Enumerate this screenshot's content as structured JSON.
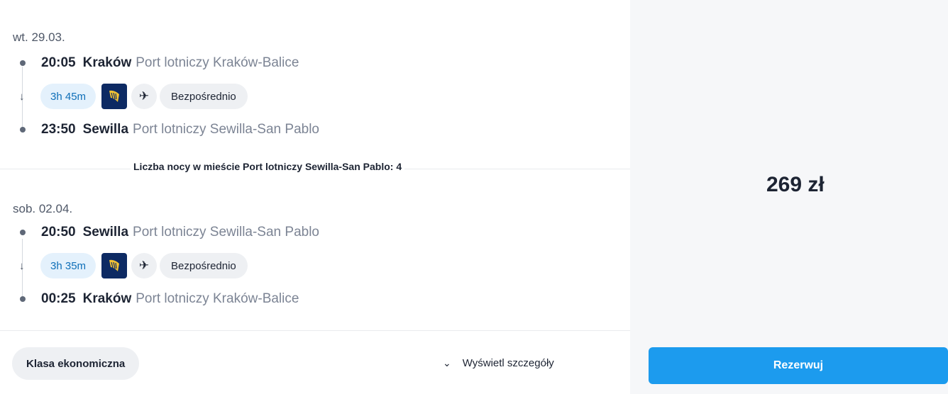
{
  "outbound": {
    "date": "wt. 29.03.",
    "departure": {
      "time": "20:05",
      "city": "Kraków",
      "airport": "Port lotniczy Kraków-Balice"
    },
    "duration": "3h 45m",
    "carrier_icon": "ryanair-harp-logo",
    "stops": "Bezpośrednio",
    "arrival": {
      "time": "23:50",
      "city": "Sewilla",
      "airport": "Port lotniczy Sewilla-San Pablo"
    }
  },
  "nights_text": "Liczba nocy w mieście Port lotniczy Sewilla-San Pablo: 4",
  "return": {
    "date": "sob. 02.04.",
    "departure": {
      "time": "20:50",
      "city": "Sewilla",
      "airport": "Port lotniczy Sewilla-San Pablo"
    },
    "duration": "3h 35m",
    "carrier_icon": "ryanair-harp-logo",
    "stops": "Bezpośrednio",
    "arrival": {
      "time": "00:25",
      "city": "Kraków",
      "airport": "Port lotniczy Kraków-Balice"
    }
  },
  "footer": {
    "cabin_class": "Klasa ekonomiczna",
    "details_label": "Wyświetl szczegóły"
  },
  "price": "269 zł",
  "book_label": "Rezerwuj",
  "colors": {
    "accent": "#1c9bee",
    "duration_bg": "#e4f1fc",
    "duration_text": "#0f6fb8",
    "carrier_bg": "#0d2a63",
    "carrier_harp": "#f2c233"
  }
}
